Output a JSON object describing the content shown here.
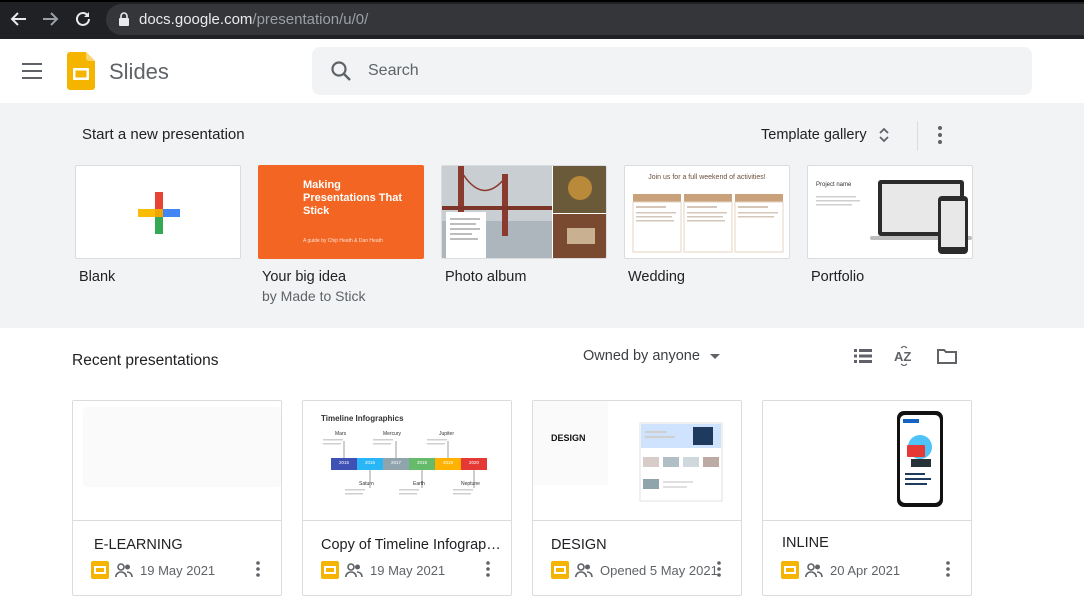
{
  "browser": {
    "url_host": "docs.google.com",
    "url_path": "/presentation/u/0/"
  },
  "header": {
    "app_name": "Slides",
    "search_placeholder": "Search"
  },
  "templates": {
    "title": "Start a new presentation",
    "gallery_label": "Template gallery",
    "items": [
      {
        "label": "Blank",
        "sub": ""
      },
      {
        "label": "Your big idea",
        "sub": "by Made to Stick",
        "thumb_title": "Making Presentations That Stick",
        "thumb_sub": "A guide by Chip Heath & Dan Heath"
      },
      {
        "label": "Photo album",
        "sub": ""
      },
      {
        "label": "Wedding",
        "sub": "",
        "thumb_title": "Join us for a full weekend of activities!"
      },
      {
        "label": "Portfolio",
        "sub": "",
        "thumb_title": "Project name"
      }
    ]
  },
  "recent": {
    "title": "Recent presentations",
    "owned_filter": "Owned by anyone",
    "docs": [
      {
        "title": "E-LEARNING",
        "date": "19 May 2021"
      },
      {
        "title": "Copy of Timeline Infographics",
        "date": "19 May 2021",
        "thumb_title": "Timeline Infographics",
        "years": [
          "2015",
          "2016",
          "2017",
          "2018",
          "2019",
          "2020"
        ],
        "planets_top": [
          "Mars",
          "Mercury",
          "Jupiter"
        ],
        "planets_bottom": [
          "Saturn",
          "Earth",
          "Neptune"
        ]
      },
      {
        "title": "DESIGN",
        "date": "Opened 5 May 2021",
        "thumb_title": "DESIGN"
      },
      {
        "title": "INLINE",
        "date": "20 Apr 2021"
      }
    ]
  },
  "colors": {
    "slides_yellow": "#f4b400",
    "accent_orange": "#f26522",
    "chrome_dark": "#202124",
    "surface_grey": "#f1f3f4"
  }
}
